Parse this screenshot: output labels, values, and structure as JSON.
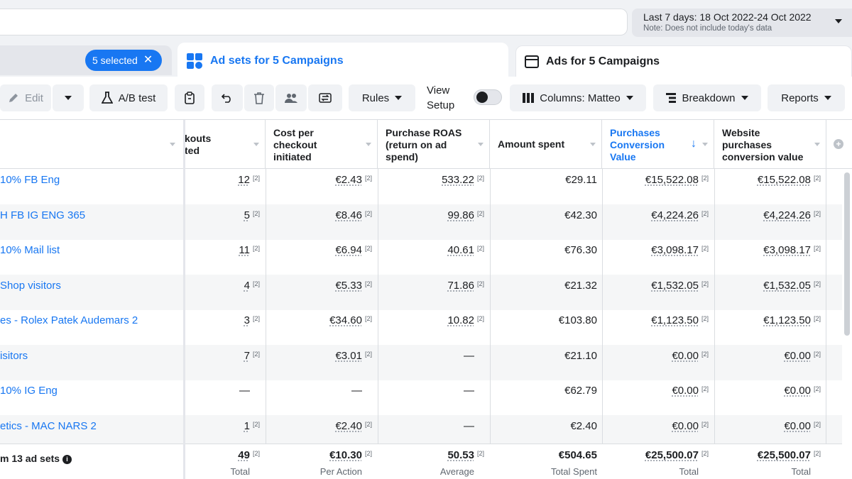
{
  "header": {
    "date_range": "Last 7 days: 18 Oct 2022-24 Oct 2022",
    "date_note": "Note: Does not include today's data"
  },
  "tabs": {
    "selected_chip": "5 selected",
    "adsets_label": "Ad sets for 5 Campaigns",
    "ads_label": "Ads for 5 Campaigns"
  },
  "toolbar": {
    "edit_label": "Edit",
    "ab_test_label": "A/B test",
    "rules_label": "Rules",
    "view_setup_line1": "View",
    "view_setup_line2": "Setup",
    "columns_label": "Columns: Matteo",
    "breakdown_label": "Breakdown",
    "reports_label": "Reports"
  },
  "columns": {
    "checkouts_l1": "kouts",
    "checkouts_l2": "ted",
    "cost_per_checkout": [
      "Cost per",
      "checkout",
      "initiated"
    ],
    "roas": [
      "Purchase ROAS",
      "(return on ad",
      "spend)"
    ],
    "amount_spent": "Amount spent",
    "purchases_value": [
      "Purchases",
      "Conversion",
      "Value"
    ],
    "website_value": [
      "Website",
      "purchases",
      "conversion value"
    ]
  },
  "rows": [
    {
      "name": "10% FB Eng",
      "checkouts": "12",
      "cost": "€2.43",
      "roas": "533.22",
      "spent": "€29.11",
      "pcv": "€15,522.08",
      "wpcv": "€15,522.08"
    },
    {
      "name": "H FB IG ENG 365",
      "checkouts": "5",
      "cost": "€8.46",
      "roas": "99.86",
      "spent": "€42.30",
      "pcv": "€4,224.26",
      "wpcv": "€4,224.26"
    },
    {
      "name": "10% Mail list",
      "checkouts": "11",
      "cost": "€6.94",
      "roas": "40.61",
      "spent": "€76.30",
      "pcv": "€3,098.17",
      "wpcv": "€3,098.17"
    },
    {
      "name": "Shop visitors",
      "checkouts": "4",
      "cost": "€5.33",
      "roas": "71.86",
      "spent": "€21.32",
      "pcv": "€1,532.05",
      "wpcv": "€1,532.05"
    },
    {
      "name": "es - Rolex Patek Audemars 2",
      "checkouts": "3",
      "cost": "€34.60",
      "roas": "10.82",
      "spent": "€103.80",
      "pcv": "€1,123.50",
      "wpcv": "€1,123.50"
    },
    {
      "name": "isitors",
      "checkouts": "7",
      "cost": "€3.01",
      "roas": "—",
      "spent": "€21.10",
      "pcv": "€0.00",
      "wpcv": "€0.00"
    },
    {
      "name": "10% IG Eng",
      "checkouts": "—",
      "cost": "—",
      "roas": "—",
      "spent": "€62.79",
      "pcv": "€0.00",
      "wpcv": "€0.00"
    },
    {
      "name": "etics - MAC NARS 2",
      "checkouts": "1",
      "cost": "€2.40",
      "roas": "—",
      "spent": "€2.40",
      "pcv": "€0.00",
      "wpcv": "€0.00"
    }
  ],
  "footnote": "[2]",
  "footer": {
    "title": "m 13 ad sets",
    "info_glyph": "i",
    "checkouts": "49",
    "checkouts_label": "Total",
    "cost": "€10.30",
    "cost_label": "Per Action",
    "roas": "50.53",
    "roas_label": "Average",
    "spent": "€504.65",
    "spent_label": "Total Spent",
    "pcv": "€25,500.07",
    "pcv_label": "Total",
    "wpcv": "€25,500.07",
    "wpcv_label": "Total"
  },
  "colors": {
    "accent": "#1877f2",
    "alt_row": "#f5f6f7"
  }
}
